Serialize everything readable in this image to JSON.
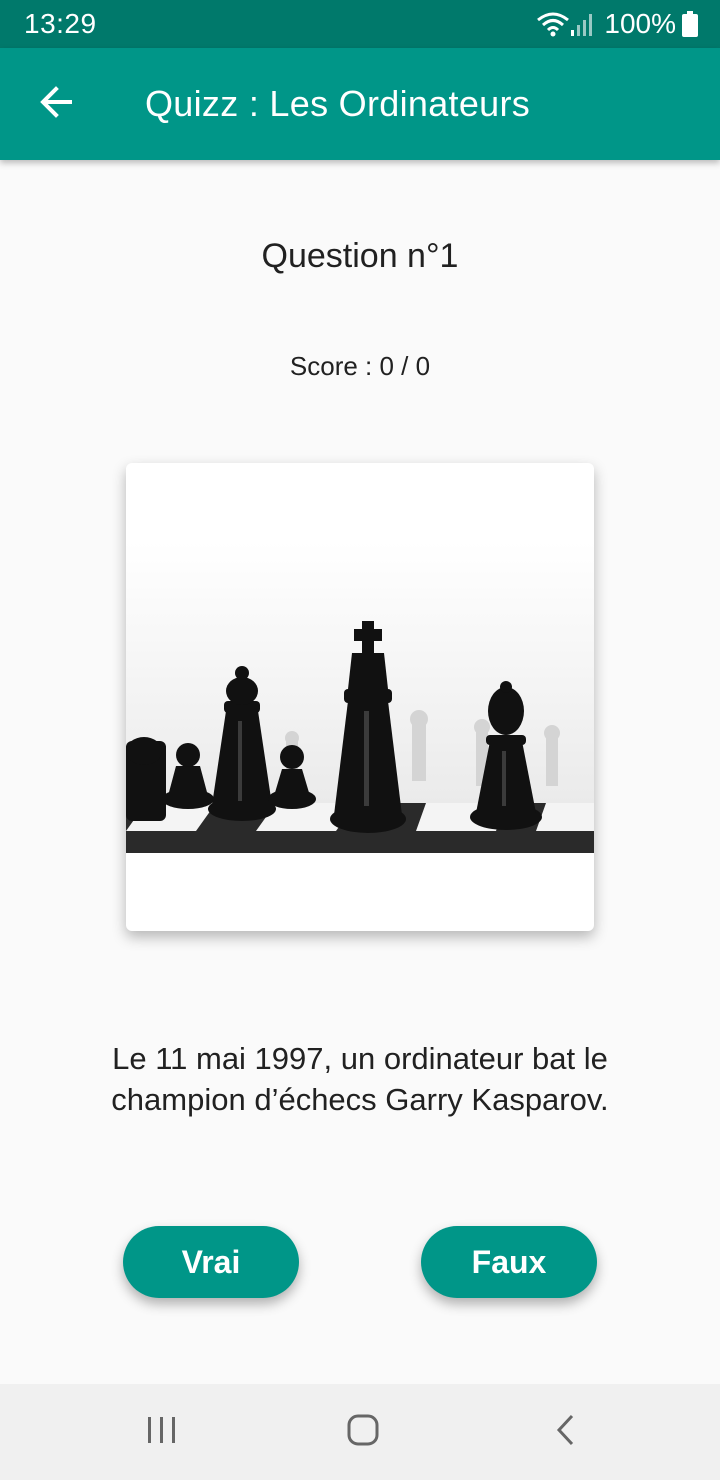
{
  "status_bar": {
    "time": "13:29",
    "battery": "100%",
    "icons": [
      "wifi-icon",
      "signal-icon",
      "battery-icon"
    ]
  },
  "app_bar": {
    "title": "Quizz : Les Ordinateurs",
    "back_icon": "arrow-back-icon"
  },
  "quiz": {
    "question_title": "Question n°1",
    "score": "Score : 0 / 0",
    "image": "chess-pieces-photo",
    "statement": "Le 11 mai 1997, un ordinateur bat le champion d’échecs Garry Kasparov.",
    "true_label": "Vrai",
    "false_label": "Faux"
  },
  "nav_bar": {
    "icons": [
      "recent-apps-icon",
      "home-icon",
      "back-icon"
    ]
  },
  "colors": {
    "status_bar": "#00796b",
    "primary": "#009688",
    "background": "#fafafa",
    "nav_bar": "#f0f0f0"
  }
}
